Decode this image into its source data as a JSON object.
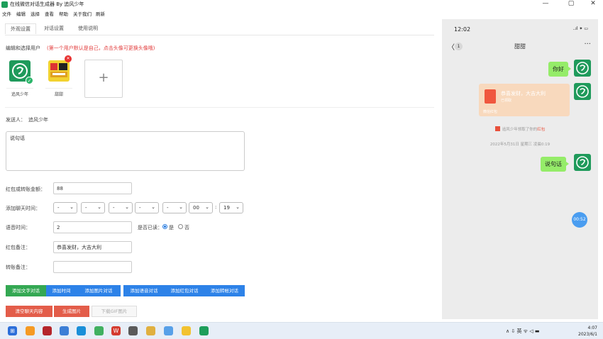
{
  "window": {
    "title": "在线微信对话生成器 By 追风少年",
    "controls": {
      "minimize": "—",
      "maximize": "▢",
      "close": "✕"
    }
  },
  "menu": [
    "文件",
    "编辑",
    "选择",
    "查看",
    "帮助",
    "关于我们",
    "刷新"
  ],
  "tabs": [
    "外观设置",
    "对话设置",
    "使用说明"
  ],
  "users_section": {
    "label": "编辑和选择用户",
    "hint": "(第一个用户默认是自己，点击头像可更换头像哦)",
    "users": [
      {
        "name": "追风少年",
        "avatar": "wechat-avatar",
        "selected": true
      },
      {
        "name": "甜甜",
        "avatar": "sticker-avatar",
        "selected": false
      }
    ],
    "add_symbol": "+"
  },
  "sender": {
    "label": "发送人：",
    "name": "追风少年"
  },
  "message": {
    "value": "说句话"
  },
  "red_amount": {
    "label": "红包或转账金额：",
    "value": "88"
  },
  "chat_time": {
    "label": "添加聊天时间：",
    "selects": [
      "-",
      "-",
      "-",
      "-",
      "-",
      "00",
      "19"
    ],
    "colon": ":"
  },
  "voice": {
    "label": "语音时间：",
    "value": "2",
    "read_label": "是否已读：",
    "yes": "是",
    "no": "否",
    "read": true
  },
  "red_note": {
    "label": "红包备注：",
    "value": "恭喜发财，大吉大利"
  },
  "transfer_note": {
    "label": "转账备注：",
    "value": ""
  },
  "buttons": {
    "add_text": "添加文字对话",
    "add_time": "添加时间",
    "add_image": "添加图片对话",
    "add_voice": "添加语音对话",
    "add_red": "添加红包对话",
    "add_transfer": "添加转帐对话",
    "clear": "清空聊天内容",
    "generate": "生成图片",
    "download_gif": "下载GIF图片"
  },
  "phone": {
    "time": "12:02",
    "signal": "..ıl ✦ ▭",
    "back": "〈",
    "unread": "1",
    "contact": "甜甜",
    "more": "···",
    "messages": [
      {
        "type": "text",
        "from": "me",
        "text": "你好"
      },
      {
        "type": "redpacket",
        "from": "me",
        "text": "恭喜发财，大吉大利",
        "sub": "已领取",
        "foot": "微信红包"
      },
      {
        "type": "system",
        "prefix": "追风少年领取了你的",
        "link": "红包"
      },
      {
        "type": "time",
        "text": "2022年5月31日 星期三 凌晨0:19"
      },
      {
        "type": "text",
        "from": "me",
        "text": "说句话"
      }
    ],
    "voice_bubble": "00:52"
  },
  "taskbar": {
    "tray": "∧  ⇩  英  ᯤ ◁ ▬",
    "time": "4:07",
    "date": "2023/6/1"
  },
  "colors": {
    "green": "#34a853",
    "blue": "#2d82e8",
    "red": "#e35d4a",
    "accent_red": "#e23b3b",
    "wechat_green": "#95ec69"
  }
}
